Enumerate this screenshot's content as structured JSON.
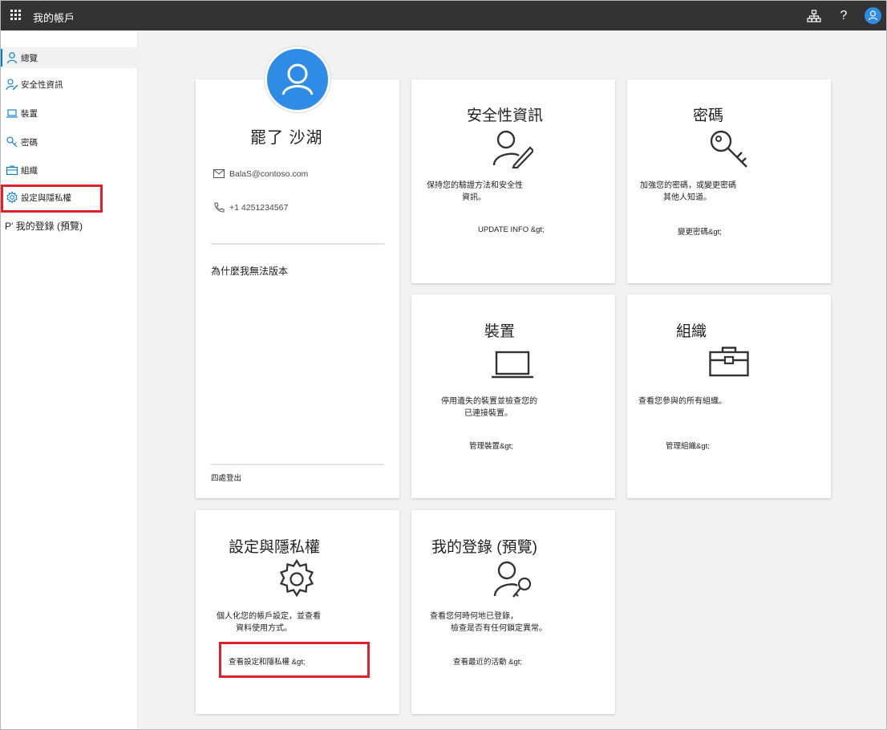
{
  "app": {
    "title": "我的帳戶"
  },
  "topbar": {
    "icons": [
      "app-launcher-icon",
      "org-chart-icon",
      "help-icon",
      "user-avatar-icon"
    ],
    "help_label": "?"
  },
  "sidebar": {
    "items": [
      {
        "label": "總覽",
        "icon": "person-icon",
        "active": true
      },
      {
        "label": "安全性資訊",
        "icon": "security-info-icon"
      },
      {
        "label": "裝置",
        "icon": "laptop-icon"
      },
      {
        "label": "密碼",
        "icon": "key-icon"
      },
      {
        "label": "組織",
        "icon": "briefcase-icon"
      },
      {
        "label": "設定與隱私權",
        "icon": "gear-icon"
      },
      {
        "label": "P' 我的登錄 (預覽)",
        "icon": ""
      }
    ]
  },
  "profile": {
    "name": "罷了 沙湖",
    "email": "BalaS@contoso.com",
    "phone": "+1 4251234567",
    "why_text": "為什麼我無法版本",
    "signout": "四處登出"
  },
  "cards": {
    "security": {
      "title": "安全性資訊",
      "desc_line1": "保持您的驗證方法和安全性",
      "desc_line2": "資訊。",
      "link": "UPDATE INFO &gt;"
    },
    "password": {
      "title": "密碼",
      "desc_line1": "加強您的密碼，或變更密碼",
      "desc_line2": "其他人知道。",
      "link": "變更密碼&gt;"
    },
    "devices": {
      "title": "裝置",
      "desc_line1": "停用遺失的裝置並檢查您的",
      "desc_line2": "已連接裝置。",
      "link": "管理裝置&gt;"
    },
    "organizations": {
      "title": "組織",
      "desc_line1": "查看您參與的所有組織。",
      "link": "管理組織&gt;"
    },
    "settings": {
      "title": "設定與隱私權",
      "desc_line1": "個人化您的帳戶設定，並查看",
      "desc_line2": "資料使用方式。",
      "link": "查看設定和隱私權 &gt;"
    },
    "signins": {
      "title": "我的登錄 (預覽)",
      "desc_line1": "查看您何時何地已登錄，",
      "desc_line2": "檢查是否有任何鎖定異常。",
      "link": "查看最近的活動 &gt;"
    }
  },
  "colors": {
    "accent": "#2f8ce6",
    "topbar": "#333333",
    "highlight": "#e0202b"
  }
}
